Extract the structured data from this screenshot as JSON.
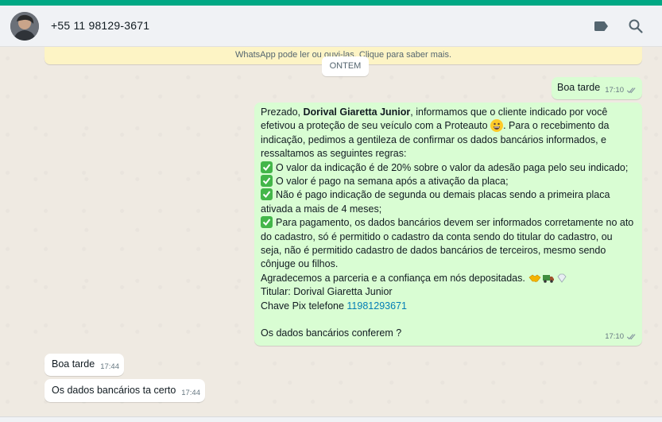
{
  "header": {
    "contact_name": "+55 11 98129-3671"
  },
  "notice": {
    "text": "WhatsApp pode ler ou ouvi-las. Clique para saber mais."
  },
  "date_separator": "ONTEM",
  "messages": {
    "m1": {
      "text": "Boa tarde",
      "time": "17:10"
    },
    "m2": {
      "p1_a": "Prezado, ",
      "p1_bold": "Dorival Giaretta Junior",
      "p1_b": ", informamos que o cliente indicado por você efetivou a proteção de seu veículo com a Proteauto",
      "p1_c": ". Para o recebimento da indicação, pedimos a gentileza de confirmar os dados bancários informados, e ressaltamos as seguintes regras:",
      "rule1": "O valor da indicação é de 20% sobre o valor da adesão paga pelo seu indicado;",
      "rule2": "O valor é pago na semana após a ativação da placa;",
      "rule3": "Não é pago indicação de segunda ou demais placas sendo a primeira placa ativada a mais de 4 meses;",
      "rule4": "Para pagamento, os dados bancários devem ser informados corretamente no ato do cadastro, só é permitido o cadastro da conta sendo do titular do cadastro, ou seja, não é permitido cadastro de dados bancários de terceiros, mesmo sendo cônjuge ou filhos.",
      "thanks": "Agradecemos a parceria e a confiança em nós depositadas.",
      "titular": "Titular: Dorival Giaretta Junior",
      "pix_label": "Chave Pix telefone ",
      "pix_number": "11981293671",
      "question": "Os dados bancários conferem ?",
      "time": "17:10"
    },
    "m3": {
      "text": "Boa tarde",
      "time": "17:44"
    },
    "m4": {
      "text": "Os dados bancários ta certo",
      "time": "17:44"
    }
  },
  "colors": {
    "accent": "#00a884",
    "outgoing_bubble": "#d9fdd3",
    "incoming_bubble": "#ffffff",
    "link": "#027eb5"
  },
  "icons": [
    "label-icon",
    "search-icon",
    "double-check-icon",
    "check-mark-emoji",
    "grinning-face-emoji",
    "handshake-emoji",
    "truck-emoji",
    "diamond-emoji"
  ]
}
